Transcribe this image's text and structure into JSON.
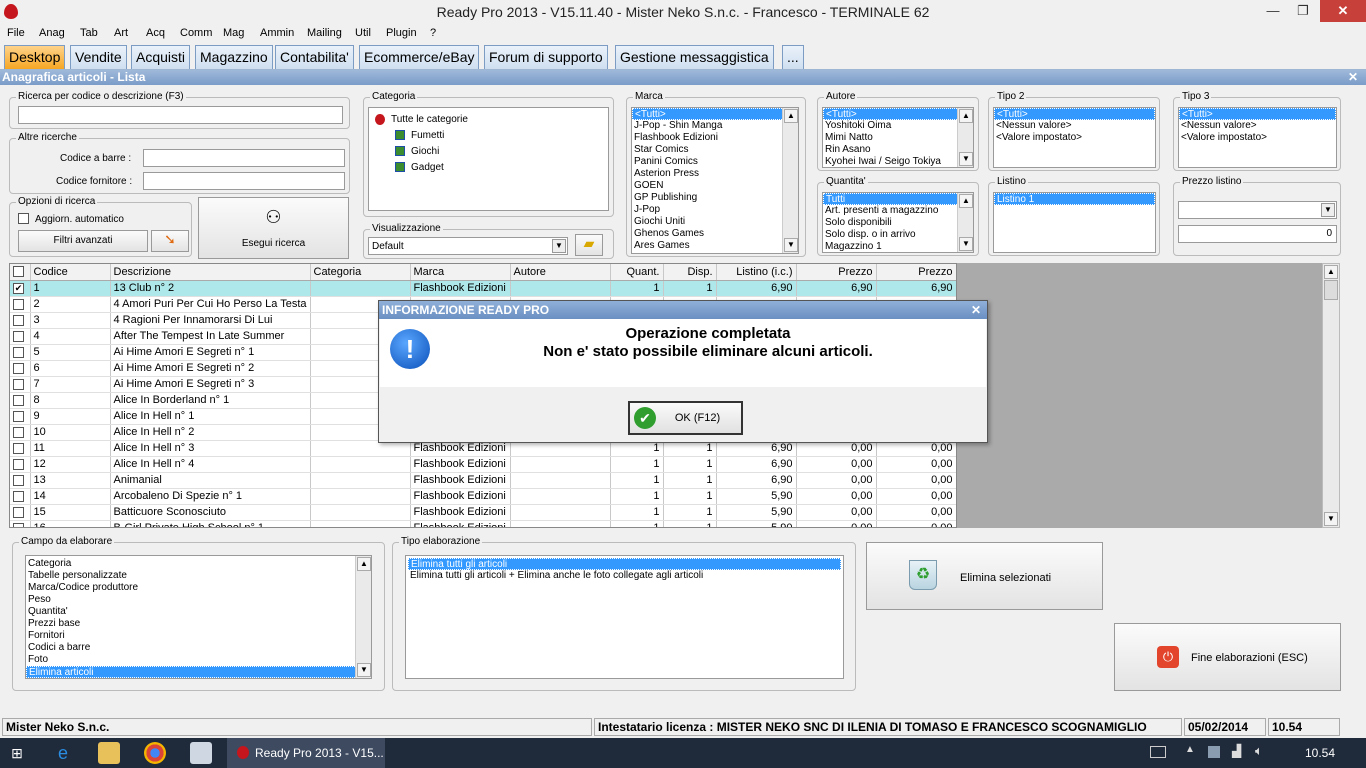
{
  "window": {
    "title": "Ready Pro 2013 - V15.11.40 - Mister Neko S.n.c. - Francesco - TERMINALE 62",
    "min": "—",
    "max": "❐",
    "close": "✕"
  },
  "menu": [
    "File",
    "Anag",
    "Tab",
    "Art",
    "Acq",
    "Comm",
    "Mag",
    "Ammin",
    "Mailing",
    "Util",
    "Plugin",
    "?"
  ],
  "tabs": [
    "Desktop",
    "Vendite",
    "Acquisti",
    "Magazzino",
    "Contabilita'",
    "Ecommerce/eBay",
    "Forum di supporto",
    "Gestione messaggistica",
    "..."
  ],
  "subtitle": {
    "text": "Anagrafica articoli  - Lista",
    "close": "✕"
  },
  "search": {
    "ricerca_label": "Ricerca per codice o descrizione (F3)",
    "altre_label": "Altre ricerche",
    "barcode_label": "Codice a barre :",
    "fornitore_label": "Codice fornitore :",
    "opzioni_label": "Opzioni di ricerca",
    "auto_label": "Aggiorn. automatico",
    "filtri_label": "Filtri avanzati",
    "esegui_label": "Esegui ricerca"
  },
  "categoria": {
    "label": "Categoria",
    "items": [
      "Tutte le categorie",
      "Fumetti",
      "Giochi",
      "Gadget"
    ]
  },
  "visualizzazione": {
    "label": "Visualizzazione",
    "value": "Default"
  },
  "marca": {
    "label": "Marca",
    "items": [
      "<Tutti>",
      "J-Pop - Shin Manga",
      "Flashbook Edizioni",
      "Star Comics",
      "Panini Comics",
      "Asterion Press",
      "GOEN",
      "GP Publishing",
      "J-Pop",
      "Giochi Uniti",
      "Ghenos Games",
      "Ares Games"
    ]
  },
  "autore": {
    "label": "Autore",
    "items": [
      "<Tutti>",
      "Yoshitoki Oima",
      "Mimi Natto",
      "Rin Asano",
      "Kyohei Iwai / Seigo Tokiya"
    ]
  },
  "quantita": {
    "label": "Quantita'",
    "items": [
      "Tutti",
      "Art. presenti a magazzino",
      "Solo disponibili",
      "Solo disp. o in arrivo",
      "Magazzino 1"
    ]
  },
  "tipo2": {
    "label": "Tipo 2",
    "items": [
      "<Tutti>",
      "<Nessun valore>",
      "<Valore impostato>"
    ]
  },
  "tipo3": {
    "label": "Tipo 3",
    "items": [
      "<Tutti>",
      "<Nessun valore>",
      "<Valore impostato>"
    ]
  },
  "listino": {
    "label": "Listino",
    "items": [
      "Listino 1"
    ]
  },
  "prezzo_listino": {
    "label": "Prezzo listino",
    "value": "0"
  },
  "grid": {
    "headers": [
      "Codice",
      "Descrizione",
      "Categoria",
      "Marca",
      "Autore",
      "Quant.",
      "Disp.",
      "Listino (i.c.)",
      "Prezzo",
      "Prezzo"
    ],
    "rows": [
      [
        "1",
        "13 Club n° 2",
        "",
        "Flashbook Edizioni",
        "",
        "1",
        "1",
        "6,90",
        "6,90",
        "6,90"
      ],
      [
        "2",
        "4 Amori Puri Per Cui Ho Perso La Testa",
        "",
        "",
        "",
        "",
        "",
        "",
        "",
        ""
      ],
      [
        "3",
        "4 Ragioni Per Innamorarsi Di Lui",
        "",
        "",
        "",
        "",
        "",
        "",
        "",
        ""
      ],
      [
        "4",
        "After The Tempest In Late Summer",
        "",
        "",
        "",
        "",
        "",
        "",
        "",
        ""
      ],
      [
        "5",
        "Ai Hime Amori E Segreti n° 1",
        "",
        "",
        "",
        "",
        "",
        "",
        "",
        ""
      ],
      [
        "6",
        "Ai Hime Amori E Segreti n° 2",
        "",
        "",
        "",
        "",
        "",
        "",
        "",
        ""
      ],
      [
        "7",
        "Ai Hime Amori E Segreti n° 3",
        "",
        "",
        "",
        "",
        "",
        "",
        "",
        ""
      ],
      [
        "8",
        "Alice In Borderland n° 1",
        "",
        "",
        "",
        "",
        "",
        "",
        "",
        ""
      ],
      [
        "9",
        "Alice In Hell n° 1",
        "",
        "",
        "",
        "",
        "",
        "",
        "",
        ""
      ],
      [
        "10",
        "Alice In Hell n° 2",
        "",
        "",
        "",
        "",
        "",
        "",
        "",
        ""
      ],
      [
        "11",
        "Alice In Hell n° 3",
        "",
        "Flashbook Edizioni",
        "",
        "1",
        "1",
        "6,90",
        "0,00",
        "0,00"
      ],
      [
        "12",
        "Alice In Hell n° 4",
        "",
        "Flashbook Edizioni",
        "",
        "1",
        "1",
        "6,90",
        "0,00",
        "0,00"
      ],
      [
        "13",
        "Animanial",
        "",
        "Flashbook Edizioni",
        "",
        "1",
        "1",
        "6,90",
        "0,00",
        "0,00"
      ],
      [
        "14",
        "Arcobaleno Di Spezie n° 1",
        "",
        "Flashbook Edizioni",
        "",
        "1",
        "1",
        "5,90",
        "0,00",
        "0,00"
      ],
      [
        "15",
        "Batticuore Sconosciuto",
        "",
        "Flashbook Edizioni",
        "",
        "1",
        "1",
        "5,90",
        "0,00",
        "0,00"
      ],
      [
        "16",
        "B-Girl Private High School n° 1",
        "",
        "Flashbook Edizioni",
        "",
        "1",
        "1",
        "5,90",
        "0,00",
        "0,00"
      ]
    ]
  },
  "dialog": {
    "title": "INFORMAZIONE READY PRO",
    "close": "✕",
    "line1": "Operazione completata",
    "line2": "Non e' stato possibile eliminare alcuni articoli.",
    "ok": "OK (F12)"
  },
  "campo": {
    "label": "Campo da elaborare",
    "items": [
      "Categoria",
      "Tabelle personalizzate",
      "Marca/Codice produttore",
      "Peso",
      "Quantita'",
      "Prezzi base",
      "Fornitori",
      "Codici a barre",
      "Foto",
      "Elimina articoli"
    ]
  },
  "tipo_elab": {
    "label": "Tipo elaborazione",
    "items": [
      "Elimina tutti gli articoli",
      "Elimina tutti gli articoli + Elimina anche le foto collegate agli articoli"
    ]
  },
  "buttons": {
    "elimina": "Elimina selezionati",
    "fine": "Fine elaborazioni (ESC)"
  },
  "status": {
    "company": "Mister Neko S.n.c.",
    "license": "Intestatario licenza : MISTER NEKO SNC DI ILENIA DI TOMASO E FRANCESCO SCOGNAMIGLIO",
    "date": "05/02/2014",
    "time": "10.54"
  },
  "taskbar": {
    "app": "Ready Pro 2013 - V15...",
    "clock": "10.54"
  },
  "colors": {
    "tab_active": "#f5a623",
    "selection": "#3399ff",
    "row_highlight": "#aee8ea"
  }
}
